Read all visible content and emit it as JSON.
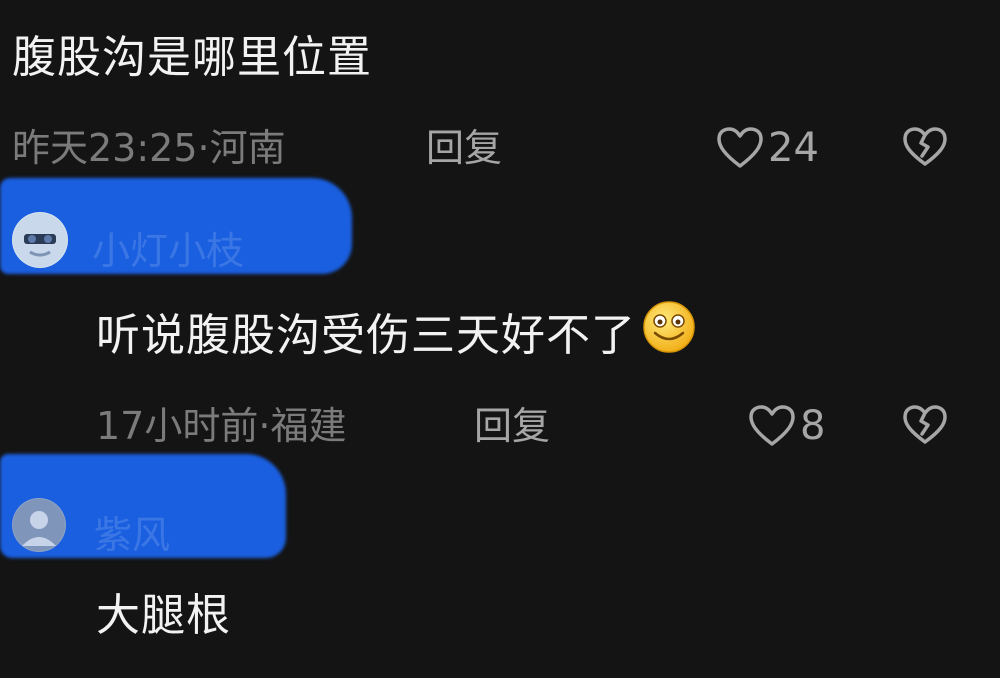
{
  "comments": [
    {
      "text": "腹股沟是哪里位置",
      "time": "昨天23:25",
      "location": "河南",
      "reply_label": "回复",
      "likes": "24"
    },
    {
      "username": "小灯小枝",
      "text": "听说腹股沟受伤三天好不了",
      "emoji": "smiley-emoji",
      "time": "17小时前",
      "location": "福建",
      "reply_label": "回复",
      "likes": "8"
    },
    {
      "username": "紫风",
      "text": "大腿根"
    }
  ],
  "separator": "·",
  "colors": {
    "background": "#141414",
    "primary_text": "#f2f2f2",
    "meta_text": "#7b7b7b",
    "action_text": "#a6a6a6",
    "redaction": "#1a5fe0"
  },
  "icons": {
    "like": "heart-outline-icon",
    "dislike": "broken-heart-icon"
  }
}
